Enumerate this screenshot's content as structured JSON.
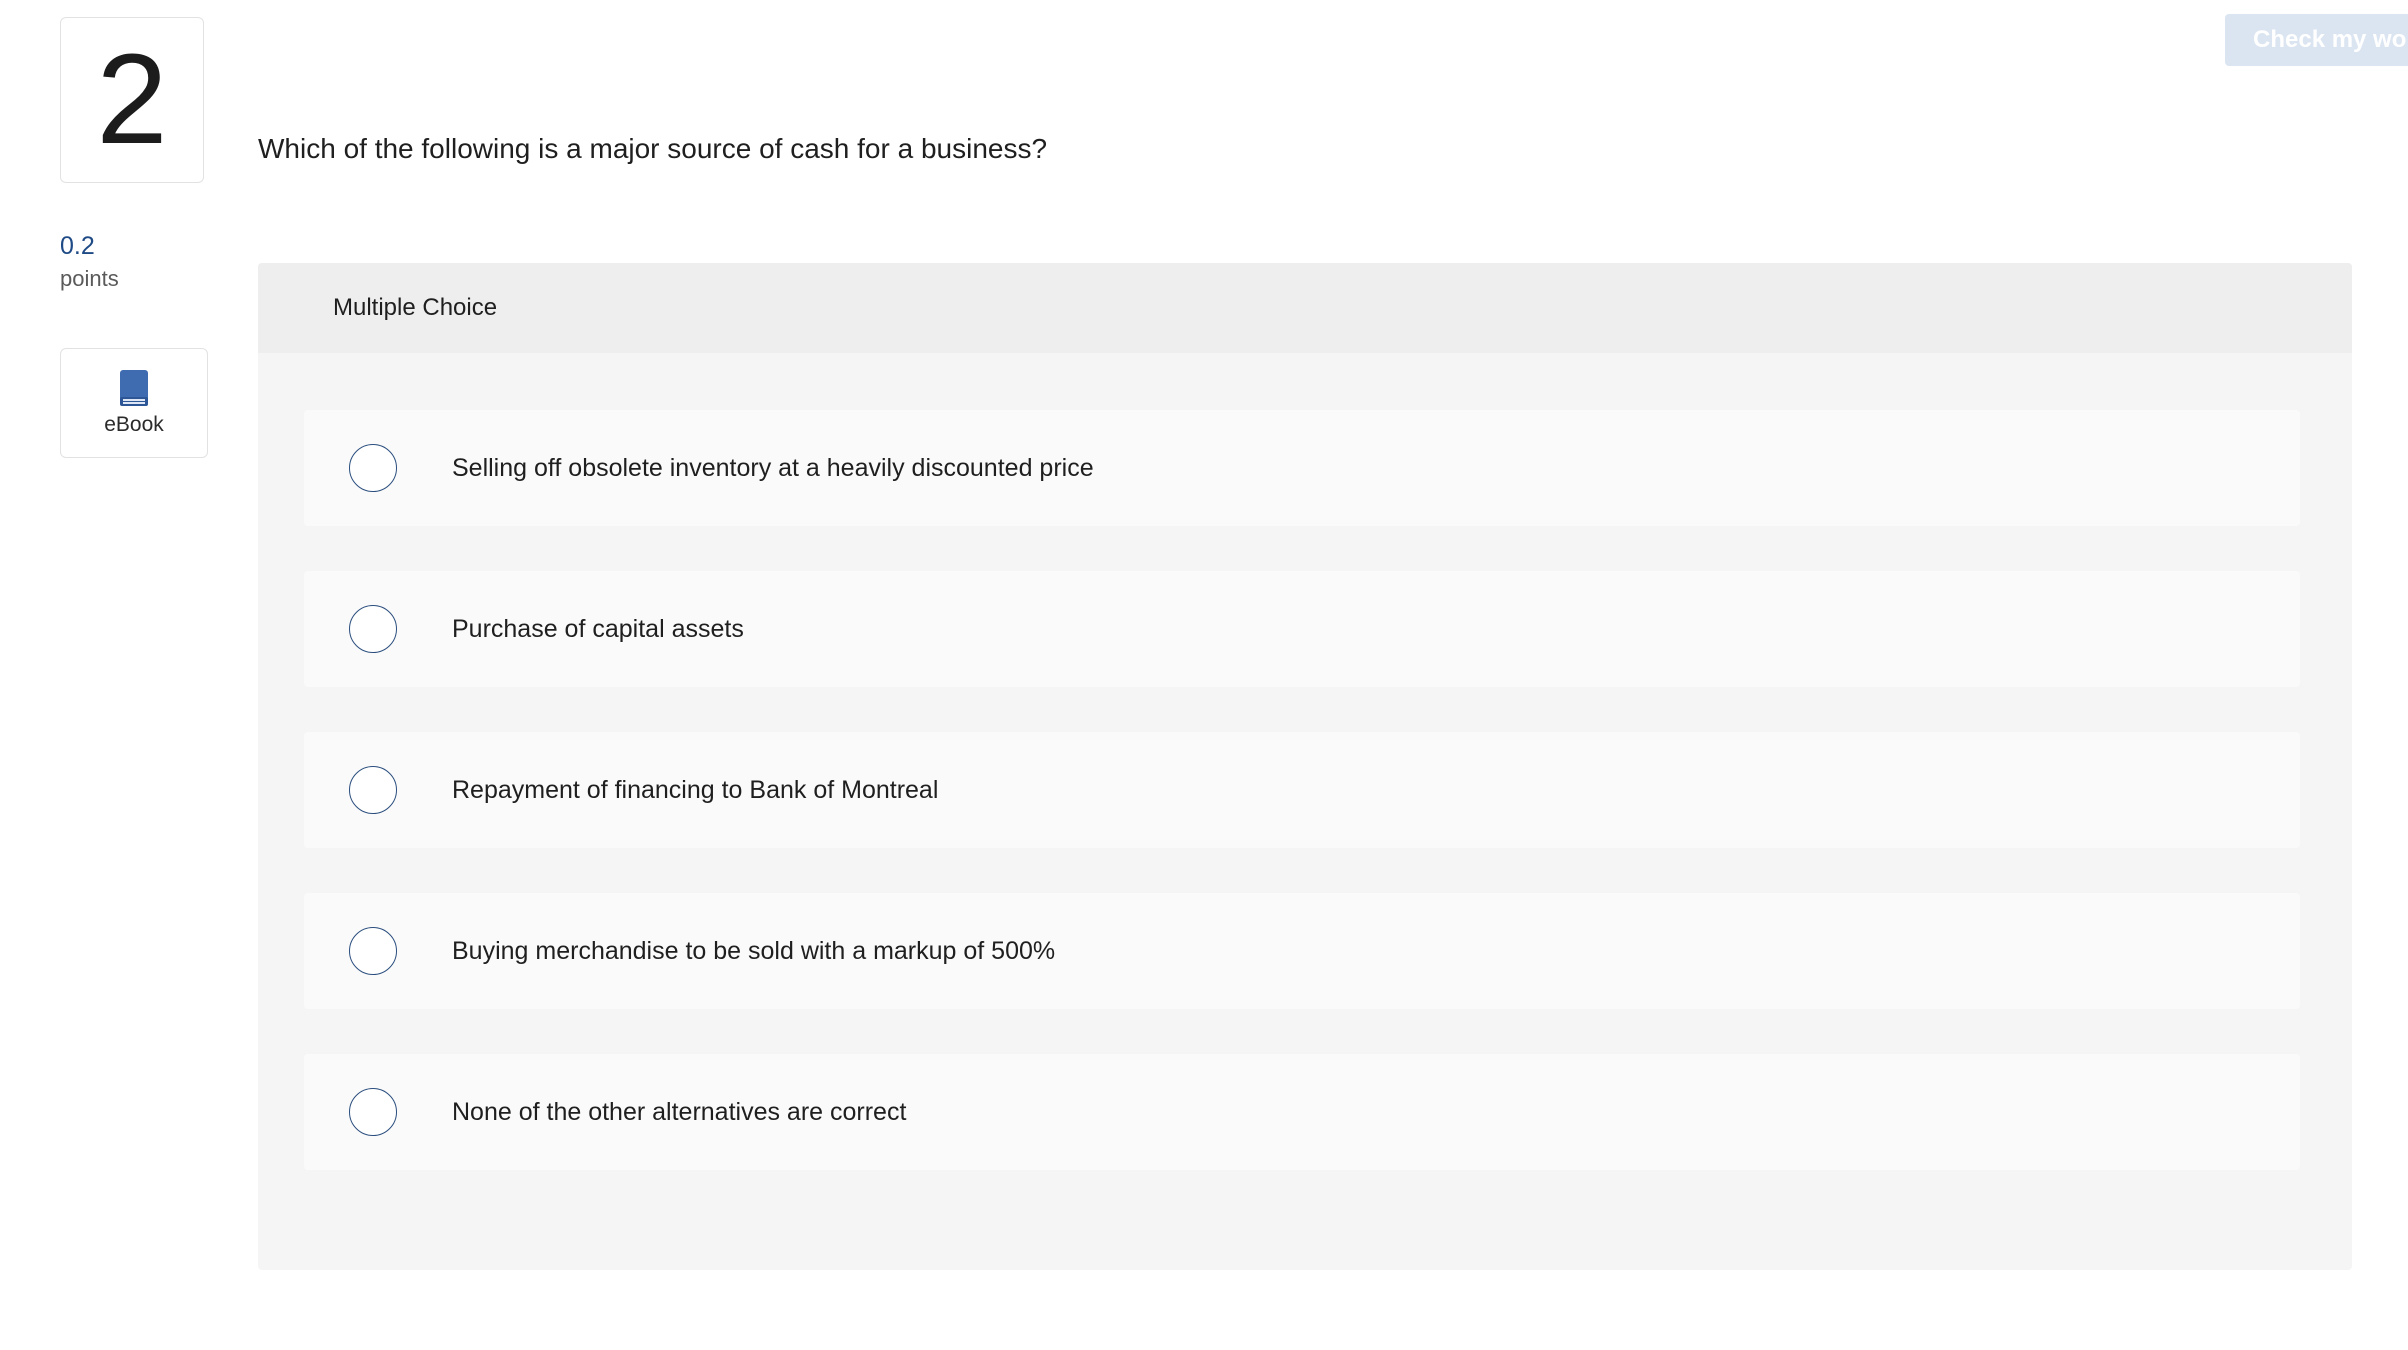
{
  "question": {
    "number": "2",
    "text": "Which of the following is a major source of cash for a business?",
    "points_value": "0.2",
    "points_label": "points"
  },
  "ebook": {
    "label": "eBook",
    "icon": "book-icon"
  },
  "toolbar": {
    "check_label": "Check my work"
  },
  "panel": {
    "header": "Multiple Choice",
    "options": [
      {
        "label": "Selling off obsolete inventory at a heavily discounted price"
      },
      {
        "label": "Purchase of capital assets"
      },
      {
        "label": "Repayment of financing to Bank of Montreal"
      },
      {
        "label": "Buying merchandise to be sold with a markup of 500%"
      },
      {
        "label": "None of the other alternatives are correct"
      }
    ]
  },
  "colors": {
    "accent": "#1e4a86",
    "radio_border": "#2b4e7e",
    "check_button_bg": "#dbe5f1",
    "panel_bg": "#f5f5f5",
    "option_bg": "#fafafa"
  }
}
